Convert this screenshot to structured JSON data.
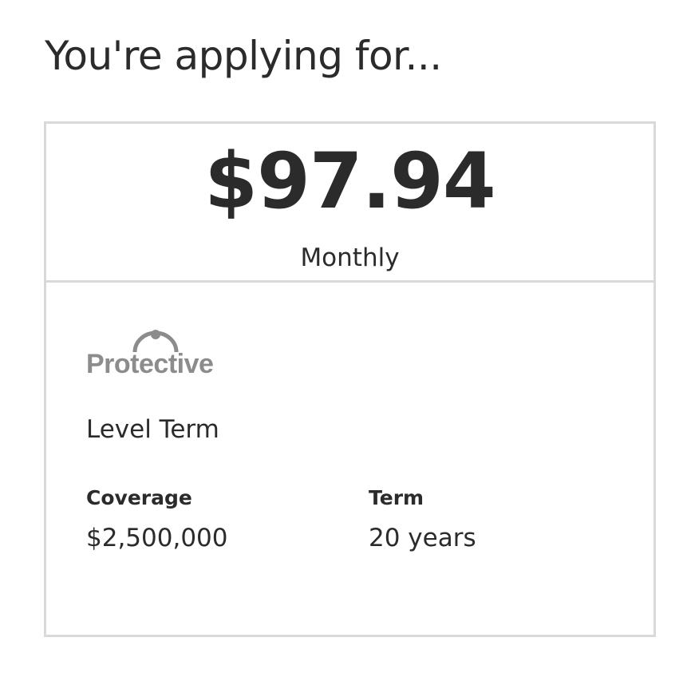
{
  "page": {
    "heading": "You're applying for..."
  },
  "quote": {
    "price": "$97.94",
    "frequency": "Monthly",
    "carrier": {
      "name": "Protective",
      "logo_icon": "protective-arc-logo-icon",
      "logo_color": "#8c8c8c"
    },
    "product": "Level Term",
    "coverage": {
      "label": "Coverage",
      "value": "$2,500,000"
    },
    "term": {
      "label": "Term",
      "value": "20 years"
    }
  },
  "colors": {
    "text": "#2b2b2b",
    "border": "#d9d9d9",
    "background": "#ffffff"
  }
}
